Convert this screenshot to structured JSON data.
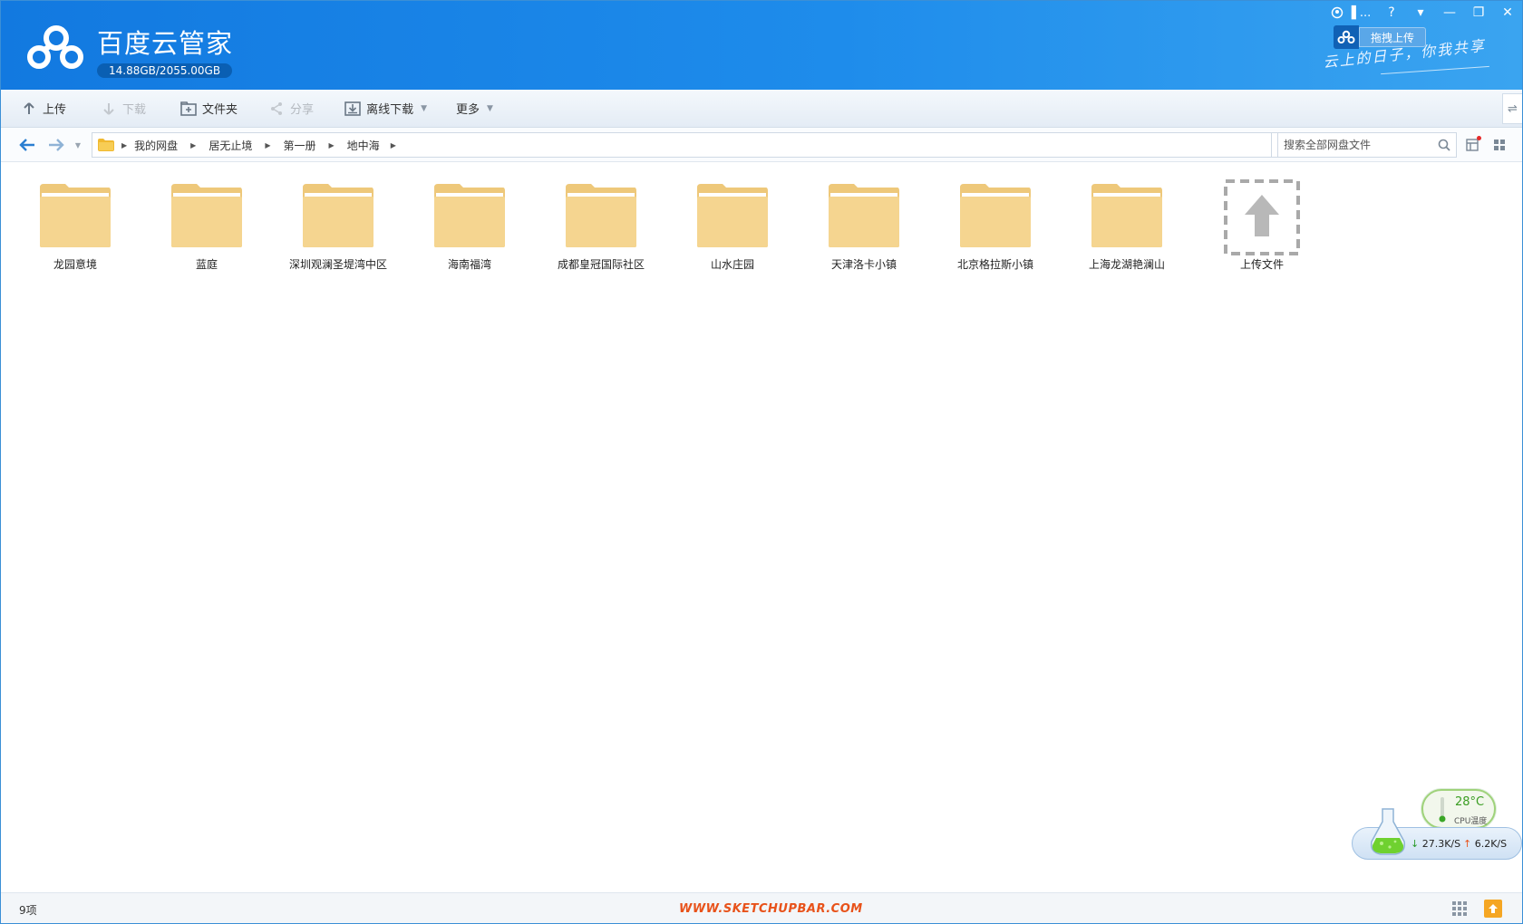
{
  "header": {
    "app_title": "百度云管家",
    "quota": "14.88GB/2055.00GB",
    "user_label": "▐ ...",
    "drag_upload_label": "拖拽上传",
    "slogan": "云上的日子，你我共享",
    "window_buttons": [
      "?",
      "▾",
      "—",
      "❐",
      "✕"
    ],
    "brand_color": "#1a84e6"
  },
  "toolbar": {
    "upload": "上传",
    "download": "下载",
    "new_folder": "文件夹",
    "share": "分享",
    "offline_download": "离线下载",
    "more": "更多"
  },
  "nav": {
    "breadcrumbs": [
      "我的网盘",
      "居无止境",
      "第一册",
      "地中海"
    ],
    "search_placeholder": "搜索全部网盘文件"
  },
  "folders": [
    {
      "name": "龙园意境"
    },
    {
      "name": "蓝庭"
    },
    {
      "name": "深圳观澜圣堤湾中区"
    },
    {
      "name": "海南福湾"
    },
    {
      "name": "成都皇冠国际社区"
    },
    {
      "name": "山水庄园"
    },
    {
      "name": "天津洛卡小镇"
    },
    {
      "name": "北京格拉斯小镇"
    },
    {
      "name": "上海龙湖艳澜山"
    }
  ],
  "upload_tile": {
    "label": "上传文件"
  },
  "status": {
    "count": "9项",
    "watermark": "WWW.SKETCHUPBAR.COM"
  },
  "widget": {
    "cpu_temp": "28°C",
    "cpu_label": "CPU温度",
    "download_speed": "27.3K/S",
    "upload_speed": "6.2K/S"
  }
}
